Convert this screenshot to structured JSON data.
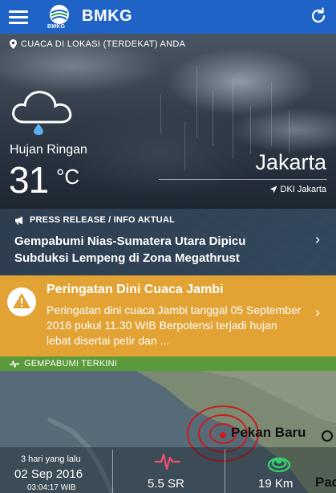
{
  "app": {
    "title": "BMKG",
    "logo_text": "BMKG"
  },
  "weather": {
    "location_hint": "CUACA DI LOKASI (TERDEKAT) ANDA",
    "condition": "Hujan Ringan",
    "temperature": "31",
    "unit": "°C",
    "city": "Jakarta",
    "province": "DKI Jakarta"
  },
  "press_release": {
    "label": "PRESS RELEASE / INFO AKTUAL",
    "title": "Gempabumi Nias-Sumatera Utara Dipicu Subduksi Lempeng di Zona Megathrust"
  },
  "warning": {
    "title": "Peringatan Dini Cuaca Jambi",
    "text": "Peringatan dini cuaca Jambi tanggal 05 September 2016 pukul 11.30 WIB Berpotensi terjadi hujan lebat disertai petir dan ...",
    "color": "#e2a234"
  },
  "earthquake": {
    "header": "GEMPABUMI TERKINI",
    "time_ago": "3 hari yang lalu",
    "date": "02 Sep 2016",
    "time": "03:04:17 WIB",
    "magnitude": "5.5 SR",
    "depth": "19 Km",
    "place": "Pekan Baru",
    "place_2": "Pada"
  },
  "colors": {
    "appbar": "#1f63c6",
    "quake_header": "#5a9a3a",
    "epicenter": "#c81e1e"
  },
  "icons": [
    "menu-icon",
    "bmkg-logo",
    "refresh-icon",
    "location-pin-icon",
    "rain-cloud-icon",
    "navigation-arrow-icon",
    "megaphone-icon",
    "chevron-right-icon",
    "warning-triangle-icon",
    "pulse-icon",
    "seismograph-icon",
    "depth-rings-icon"
  ]
}
